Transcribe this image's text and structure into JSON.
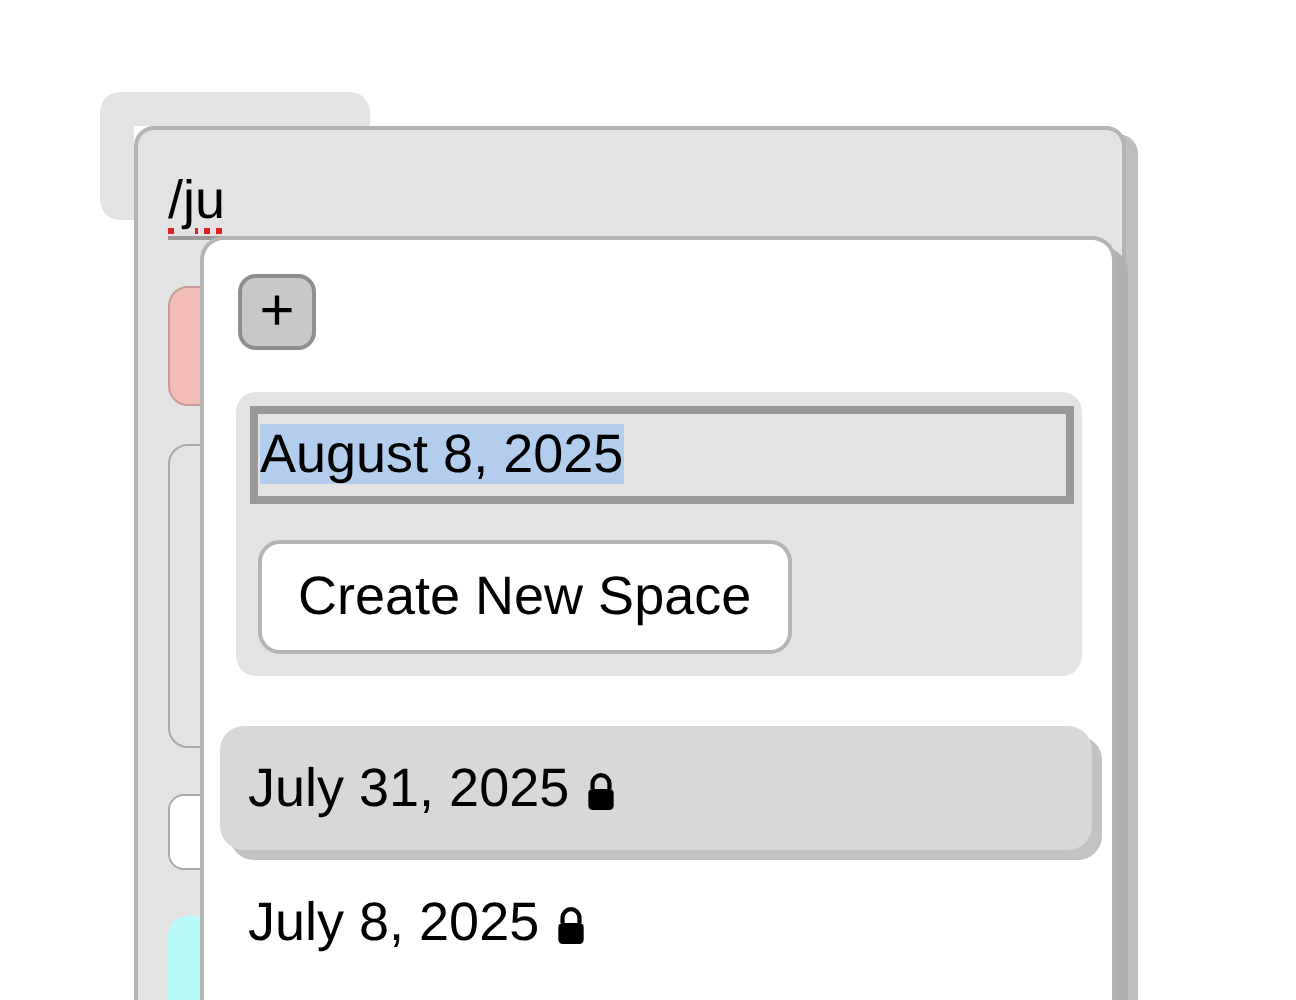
{
  "search": {
    "value": "/ju",
    "misspelled": true
  },
  "popup": {
    "add_button": "+",
    "date_field": {
      "value": "August 8, 2025",
      "text_selected": true
    },
    "create_button": "Create New Space",
    "items": [
      {
        "label": "July 31, 2025",
        "locked": true,
        "selected": true
      },
      {
        "label": "July 8, 2025",
        "locked": true,
        "selected": false
      }
    ]
  }
}
